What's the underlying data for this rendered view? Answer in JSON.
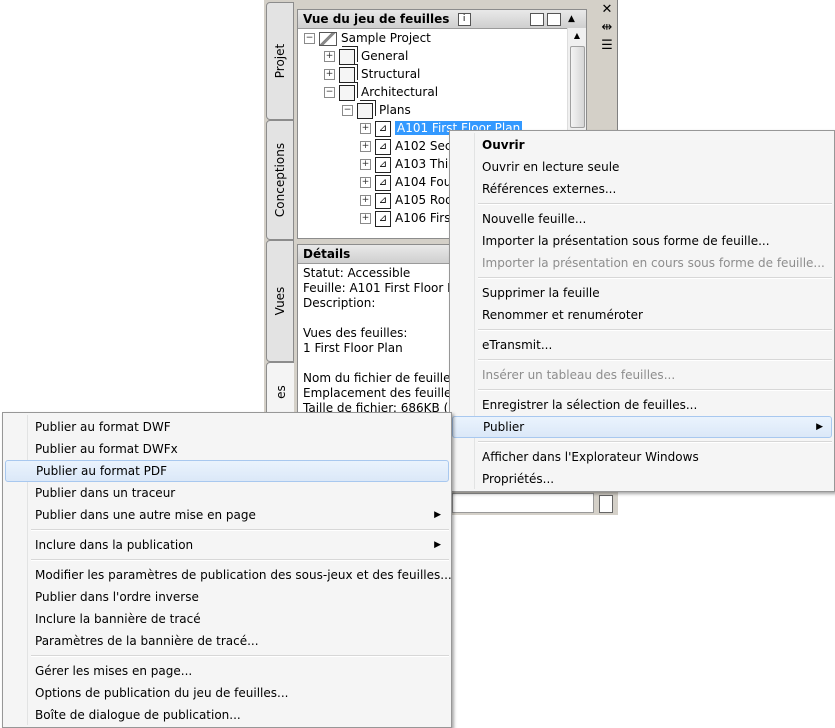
{
  "palette": {
    "tabs": [
      "Projet",
      "Conceptions",
      "Vues",
      "es"
    ],
    "right_icons": [
      "close-icon",
      "autohide-icon",
      "properties-icon"
    ]
  },
  "tree": {
    "title": "Vue du jeu de feuilles",
    "info_icon": "i",
    "rows": [
      {
        "label": "Sample Project",
        "exp": "−"
      },
      {
        "label": "General",
        "exp": "+"
      },
      {
        "label": "Structural",
        "exp": "+"
      },
      {
        "label": "Architectural",
        "exp": "−"
      },
      {
        "label": "Plans",
        "exp": "−"
      },
      {
        "label": "A101 First Floor Plan",
        "exp": "+"
      },
      {
        "label": "A102 Seco",
        "exp": "+"
      },
      {
        "label": "A103 Thir",
        "exp": "+"
      },
      {
        "label": "A104 Fou",
        "exp": "+"
      },
      {
        "label": "A105 Roo",
        "exp": "+"
      },
      {
        "label": "A106 First",
        "exp": "+"
      }
    ]
  },
  "details": {
    "title": "Détails",
    "lines": [
      "Statut: Accessible",
      "Feuille: A101 First Floor Plan",
      "Description:",
      "",
      "Vues des feuilles:",
      "1 First Floor Plan",
      "",
      "Nom du fichier de feuille: A",
      "Emplacement des feuilles: C",
      "Taille de fichier: 686KB (702"
    ]
  },
  "context_menu": {
    "items": [
      {
        "label": "Ouvrir",
        "bold": true
      },
      {
        "label": "Ouvrir en lecture seule"
      },
      {
        "label": "Références externes..."
      },
      {
        "sep": true
      },
      {
        "label": "Nouvelle feuille..."
      },
      {
        "label": "Importer la présentation sous forme de feuille..."
      },
      {
        "label": "Importer la présentation en cours sous forme de feuille...",
        "disabled": true
      },
      {
        "sep": true
      },
      {
        "label": "Supprimer la feuille"
      },
      {
        "label": "Renommer et renuméroter"
      },
      {
        "sep": true
      },
      {
        "label": "eTransmit..."
      },
      {
        "sep": true
      },
      {
        "label": "Insérer un tableau des feuilles...",
        "disabled": true
      },
      {
        "sep": true
      },
      {
        "label": "Enregistrer la sélection de feuilles..."
      },
      {
        "label": "Publier",
        "submenu": true,
        "hover": true
      },
      {
        "sep": true
      },
      {
        "label": "Afficher dans l'Explorateur Windows"
      },
      {
        "label": "Propriétés..."
      }
    ]
  },
  "publish_menu": {
    "items": [
      {
        "label": "Publier au format DWF"
      },
      {
        "label": "Publier au format DWFx"
      },
      {
        "label": "Publier au format PDF",
        "hover": true
      },
      {
        "label": "Publier dans un traceur"
      },
      {
        "label": "Publier dans une autre mise en page",
        "submenu": true
      },
      {
        "sep": true
      },
      {
        "label": "Inclure dans la publication",
        "submenu": true
      },
      {
        "sep": true
      },
      {
        "label": "Modifier les paramètres de publication des sous-jeux et des feuilles..."
      },
      {
        "label": "Publier dans l'ordre inverse"
      },
      {
        "label": "Inclure la bannière de tracé"
      },
      {
        "label": "Paramètres de la bannière de tracé..."
      },
      {
        "sep": true
      },
      {
        "label": "Gérer les mises en page..."
      },
      {
        "label": "Options de publication du jeu de feuilles..."
      },
      {
        "label": "Boîte de dialogue de publication..."
      }
    ]
  }
}
